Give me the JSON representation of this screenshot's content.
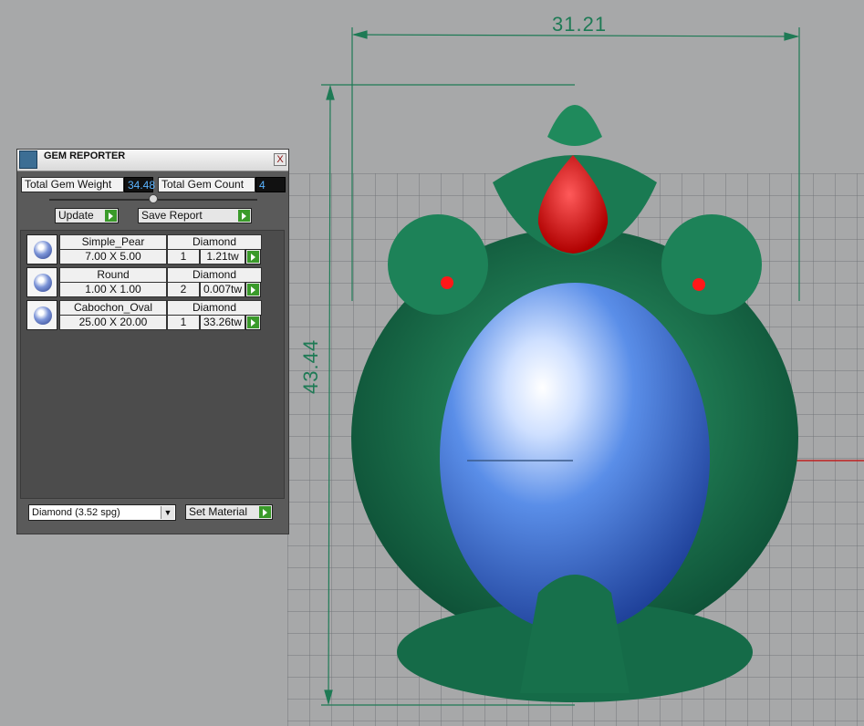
{
  "dimensions": {
    "width_label": "31.21",
    "height_label": "43.44"
  },
  "gem_reporter": {
    "title": "GEM REPORTER",
    "close_label": "X",
    "total_weight_label": "Total Gem Weight",
    "total_weight_value": "34.48",
    "total_count_label": "Total Gem Count",
    "total_count_value": "4",
    "update_label": "Update",
    "save_report_label": "Save Report",
    "gems": [
      {
        "shape": "Simple_Pear",
        "material": "Diamond",
        "size": "7.00 X 5.00",
        "count": "1",
        "weight": "1.21tw",
        "icon": "pear-gem-icon"
      },
      {
        "shape": "Round",
        "material": "Diamond",
        "size": "1.00 X 1.00",
        "count": "2",
        "weight": "0.007tw",
        "icon": "round-gem-icon"
      },
      {
        "shape": "Cabochon_Oval",
        "material": "Diamond",
        "size": "25.00 X 20.00",
        "count": "1",
        "weight": "33.26tw",
        "icon": "oval-gem-icon"
      }
    ],
    "material_select": "Diamond    (3.52 spg)",
    "set_material_label": "Set Material"
  },
  "colors": {
    "panel_bg": "#5a5a5a",
    "value_text": "#5ab4ff",
    "model_green": "#1f7a55",
    "gem_red": "#e01010",
    "cabochon_blue": "#3d6fd8",
    "dimension_green": "#1e7a55"
  }
}
